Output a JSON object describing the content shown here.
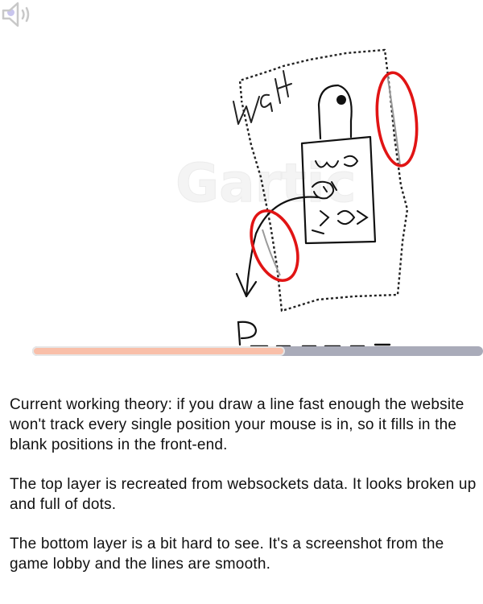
{
  "player": {
    "indicator_color": "#c9c6ee",
    "speaker_icon": "speaker-icon",
    "progress": 0.56,
    "progress_color": "#f9bfa9",
    "track_color": "#a9abb9"
  },
  "drawing": {
    "watermark": "Gartic",
    "wall_label": "wall",
    "bottom_label": "P",
    "circle_color": "#e11414"
  },
  "caption": {
    "paragraphs": [
      "Current working theory: if you draw a line fast enough the website won't track every single position your mouse is in, so it fills in the blank positions in the front-end.",
      "The top layer is recreated from websockets data. It looks broken up and full of dots.",
      "The bottom layer is a bit hard to see. It's a screenshot from the game lobby and the lines are smooth."
    ]
  }
}
